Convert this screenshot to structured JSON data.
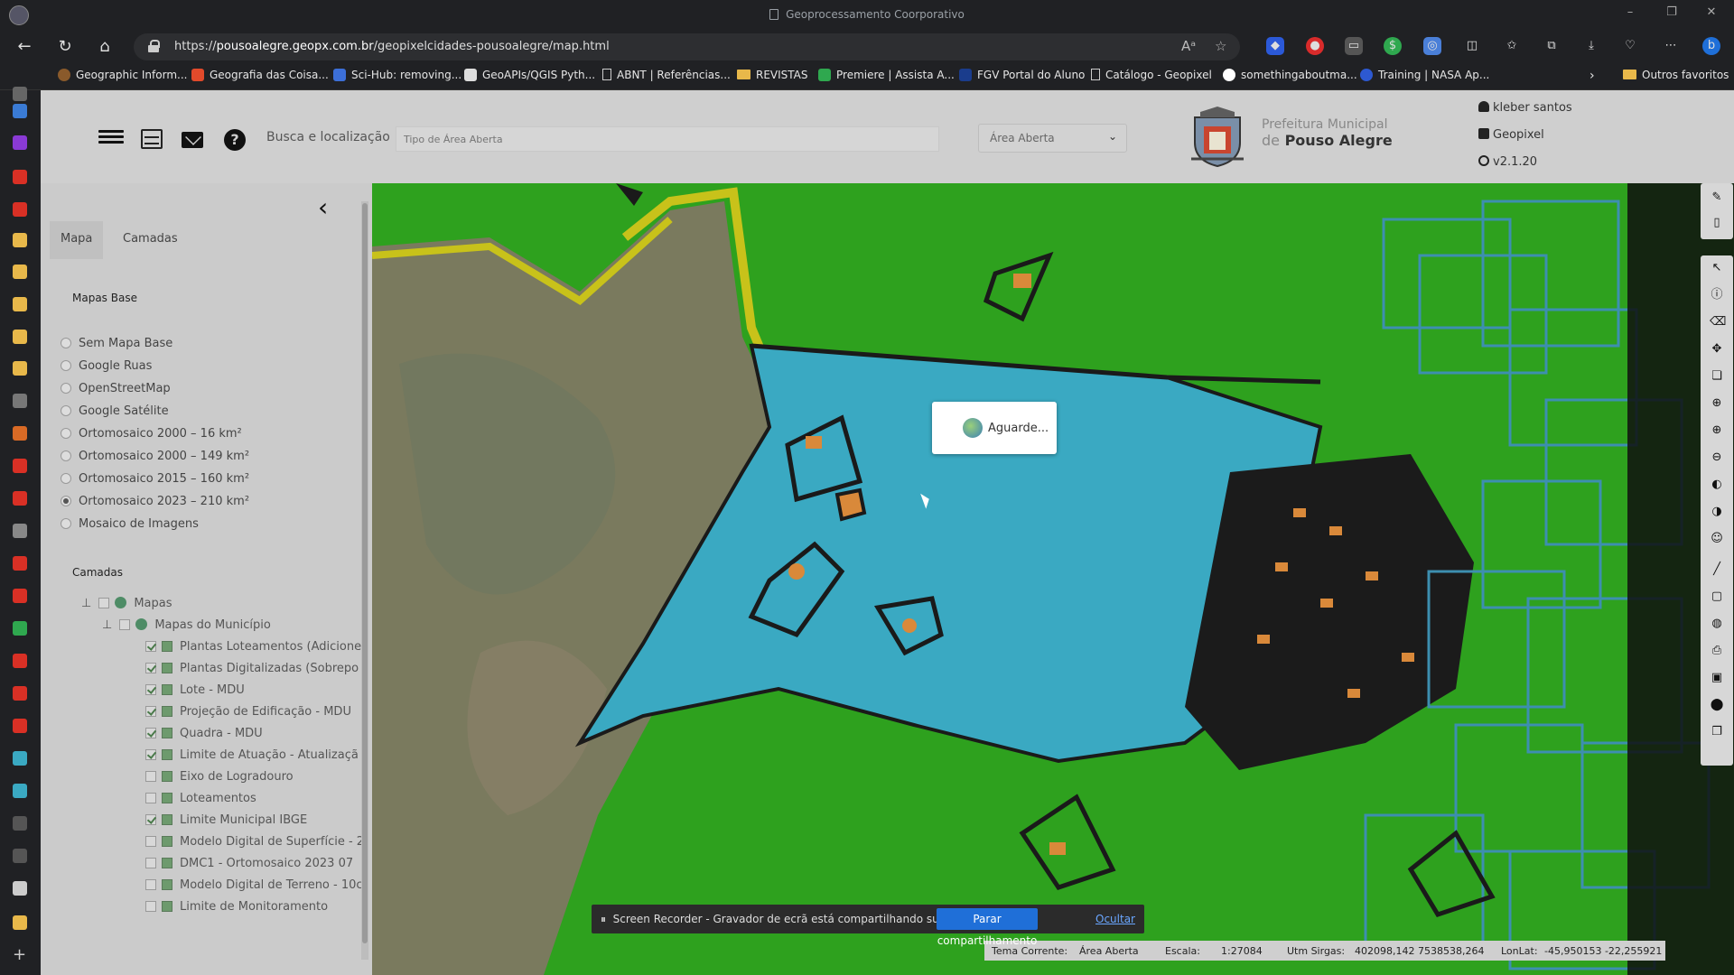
{
  "window": {
    "title": "Geoprocessamento Coorporativo"
  },
  "address_bar": {
    "url_scheme": "https://",
    "url_host": "pousoalegre.geopx.com.br",
    "url_path": "/geopixelcidades-pousoalegre/map.html"
  },
  "bookmarks": [
    {
      "label": "Geographic Inform...",
      "icon": "globe-icon",
      "color": "#8a5a2b"
    },
    {
      "label": "Geografia das Coisa...",
      "icon": "blog-icon",
      "color": "#e24a2b"
    },
    {
      "label": "Sci-Hub: removing...",
      "icon": "bird-icon",
      "color": "#3c6fd8"
    },
    {
      "label": "GeoAPIs/QGIS Pyth...",
      "icon": "search-icon",
      "color": "#dddddd"
    },
    {
      "label": "ABNT | Referências...",
      "icon": "page-icon",
      "color": "#cccccc"
    },
    {
      "label": "REVISTAS",
      "icon": "folder-icon",
      "color": "#e8b84a"
    },
    {
      "label": "Premiere | Assista A...",
      "icon": "p-icon",
      "color": "#2fa84f"
    },
    {
      "label": "FGV Portal do Aluno",
      "icon": "fgv-icon",
      "color": "#1a3c8c"
    },
    {
      "label": "Catálogo - Geopixel",
      "icon": "page-icon",
      "color": "#cccccc"
    },
    {
      "label": "somethingaboutma...",
      "icon": "wp-icon",
      "color": "#ffffff"
    },
    {
      "label": "Training | NASA Ap...",
      "icon": "nasa-icon",
      "color": "#2d59d1"
    }
  ],
  "bookmarks_other": "Outros favoritos",
  "app": {
    "search_label": "Busca e localização",
    "search_placeholder": "Tipo de Área Aberta",
    "area_select": "Área Aberta",
    "prefeitura_line1": "Prefeitura Municipal",
    "prefeitura_line2_prefix": "de",
    "prefeitura_city": "Pouso Alegre",
    "user_name": "kleber santos",
    "org": "Geopixel",
    "version": "v2.1.20"
  },
  "panel": {
    "tabs": [
      "Mapa",
      "Camadas"
    ],
    "active_tab": "Mapa",
    "basemaps_title": "Mapas Base",
    "basemaps": [
      {
        "label": "Sem Mapa Base",
        "checked": false
      },
      {
        "label": "Google Ruas",
        "checked": false
      },
      {
        "label": "OpenStreetMap",
        "checked": false
      },
      {
        "label": "Google Satélite",
        "checked": false
      },
      {
        "label": "Ortomosaico 2000 – 16 km²",
        "checked": false
      },
      {
        "label": "Ortomosaico 2000 – 149 km²",
        "checked": false
      },
      {
        "label": "Ortomosaico 2015 – 160 km²",
        "checked": false
      },
      {
        "label": "Ortomosaico 2023 – 210 km²",
        "checked": true
      },
      {
        "label": "Mosaico de Imagens",
        "checked": false
      }
    ],
    "layers_title": "Camadas",
    "tree_root": "Mapas",
    "tree_group": "Mapas do Município",
    "layers": [
      {
        "label": "Plantas Loteamentos (Adicione",
        "checked": true
      },
      {
        "label": "Plantas Digitalizadas (Sobrepo",
        "checked": true
      },
      {
        "label": "Lote - MDU",
        "checked": true
      },
      {
        "label": "Projeção de Edificação - MDU",
        "checked": true
      },
      {
        "label": "Quadra - MDU",
        "checked": true
      },
      {
        "label": "Limite de Atuação - Atualizaçã",
        "checked": true
      },
      {
        "label": "Eixo de Logradouro",
        "checked": false
      },
      {
        "label": "Loteamentos",
        "checked": false
      },
      {
        "label": "Limite Municipal IBGE",
        "checked": true
      },
      {
        "label": "Modelo Digital de Superfície - 2",
        "checked": false
      },
      {
        "label": "DMC1 - Ortomosaico 2023 07",
        "checked": false
      },
      {
        "label": "Modelo Digital de Terreno - 10c",
        "checked": false
      },
      {
        "label": "Limite de Monitoramento",
        "checked": false
      }
    ]
  },
  "map": {
    "loading_text": "Aguarde..."
  },
  "statusbar": {
    "tema_label": "Tema Corrente:",
    "tema_value": "Área Aberta",
    "escala_label": "Escala:",
    "escala_value": "1:27084",
    "utm_label": "Utm Sirgas:",
    "utm_value": "402098,142 7538538,264",
    "lonlat_label": "LonLat:",
    "lonlat_value": "-45,950153 -22,255921"
  },
  "share_notice": {
    "message": "Screen Recorder - Gravador de ecrã está compartilhando sua tela.",
    "stop_label": "Parar compartilhamento",
    "hide_label": "Ocultar"
  },
  "colors": {
    "map_green": "#2ea11e",
    "map_water": "#3aa9c2",
    "outline_yellow": "#c8c21a",
    "parcel_orange": "#d9893a",
    "grid_blue": "#3d8fb0"
  }
}
